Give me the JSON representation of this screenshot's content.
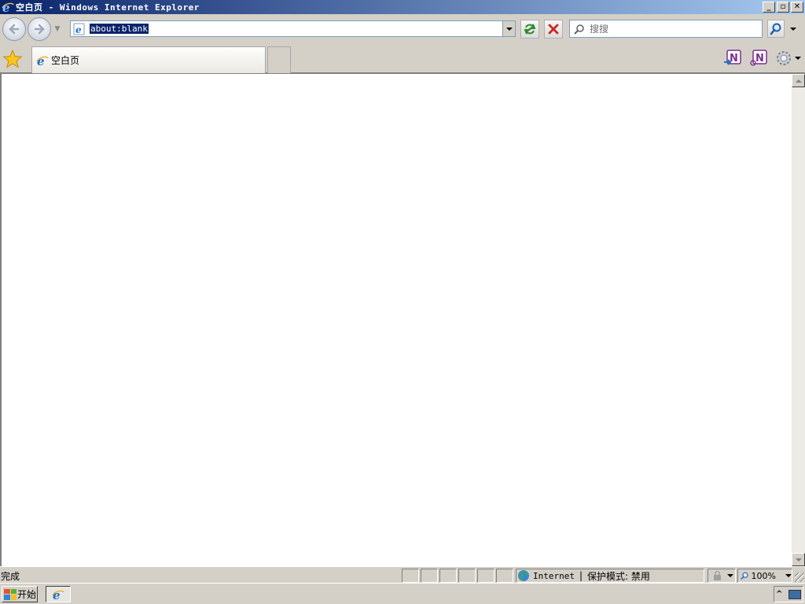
{
  "window": {
    "title": "空白页 - Windows Internet Explorer",
    "controls": {
      "minimize": "_",
      "maximize": "▫",
      "close": "✕"
    }
  },
  "navigation": {
    "back_icon": "back-arrow-icon",
    "forward_icon": "forward-arrow-icon",
    "recent_pages_icon": "chevron-down-icon",
    "address": {
      "value": "about:blank"
    },
    "refresh_icon": "refresh-icon",
    "stop_icon": "stop-icon",
    "search": {
      "placeholder": "搜搜"
    },
    "search_button_icon": "search-icon"
  },
  "tabs": [
    {
      "label": "空白页",
      "active": true
    }
  ],
  "toolbar": {
    "favorites_icon": "star-icon",
    "onenote_icons": [
      "onenote-send-icon",
      "onenote-linked-icon"
    ],
    "tools_icon": "gear-icon"
  },
  "status": {
    "text": "完成",
    "zone": "Internet",
    "protected_mode": "保护模式: 禁用",
    "zoom": "100%"
  },
  "taskbar": {
    "start_label": "开始",
    "task_icon": "ie-icon",
    "tray_chevron": "^"
  },
  "colors": {
    "titlebar_start": "#0a246a",
    "titlebar_end": "#a6caf0",
    "chrome": "#d4d0c8",
    "selection": "#0a246a",
    "ie_blue": "#1f6fc5"
  }
}
